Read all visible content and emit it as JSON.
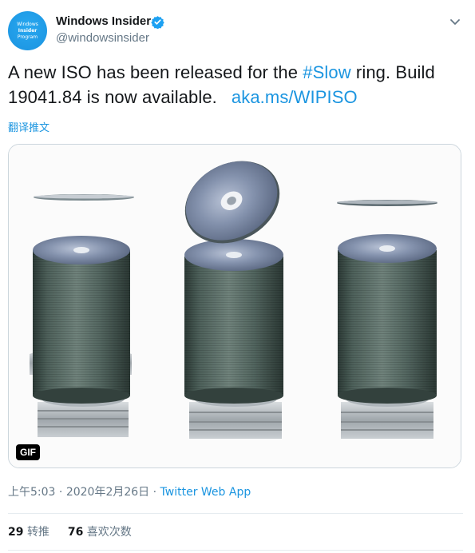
{
  "author": {
    "display_name": "Windows Insider",
    "handle": "@windowsinsider",
    "verified": true,
    "avatar_lines": [
      "Windows",
      "Insider",
      "Program"
    ]
  },
  "tweet": {
    "text_before_hashtag": "A new ISO has been released for the ",
    "hashtag": "#Slow",
    "text_after_hashtag": " ring. Build",
    "text_line2": "19041.84 is now available.",
    "link": "aka.ms/WIPISO",
    "translate_label": "翻译推文"
  },
  "media": {
    "badge": "GIF",
    "icon": "gif-badge"
  },
  "meta": {
    "time": "上午5:03",
    "separator": "·",
    "date": "2020年2月26日",
    "source": "Twitter Web App"
  },
  "stats": {
    "retweets_count": "29",
    "retweets_label": "转推",
    "likes_count": "76",
    "likes_label": "喜欢次数"
  },
  "colors": {
    "link": "#1b95e0",
    "secondary_text": "#657786",
    "verified": "#1da1f2"
  }
}
